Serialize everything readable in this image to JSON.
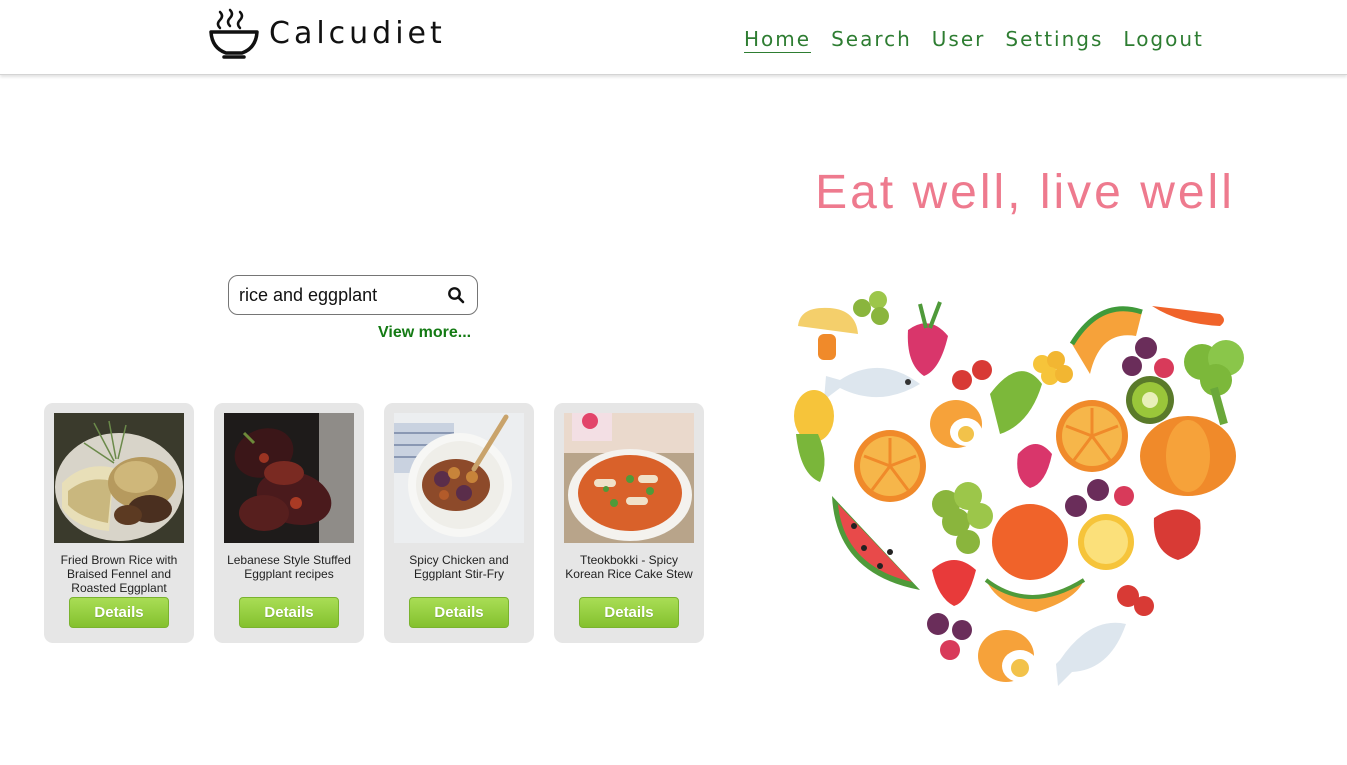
{
  "header": {
    "brand_name": "Calcudiet",
    "nav": [
      "Home",
      "Search",
      "User",
      "Settings",
      "Logout"
    ],
    "active": "Home"
  },
  "hero": {
    "tagline": "Eat well, live well"
  },
  "search": {
    "value": "rice and eggplant",
    "placeholder": "",
    "view_more": "View more..."
  },
  "recipes": [
    {
      "title": "Fried Brown Rice with Braised Fennel and Roasted Eggplant",
      "button": "Details"
    },
    {
      "title": "Lebanese Style Stuffed Eggplant recipes",
      "button": "Details"
    },
    {
      "title": "Spicy Chicken and Eggplant Stir-Fry",
      "button": "Details"
    },
    {
      "title": "Tteokbokki - Spicy Korean Rice Cake Stew",
      "button": "Details"
    }
  ],
  "colors": {
    "nav_green": "#2e7d32",
    "tagline_pink": "#ee7a8e",
    "view_more_green": "#137a13",
    "button_green": "#94cd3e",
    "card_gray": "#e6e6e6"
  },
  "icons": {
    "logo": "soup-bowl-icon",
    "search": "search-icon",
    "heart": "fruit-vegetable-heart-illustration"
  }
}
